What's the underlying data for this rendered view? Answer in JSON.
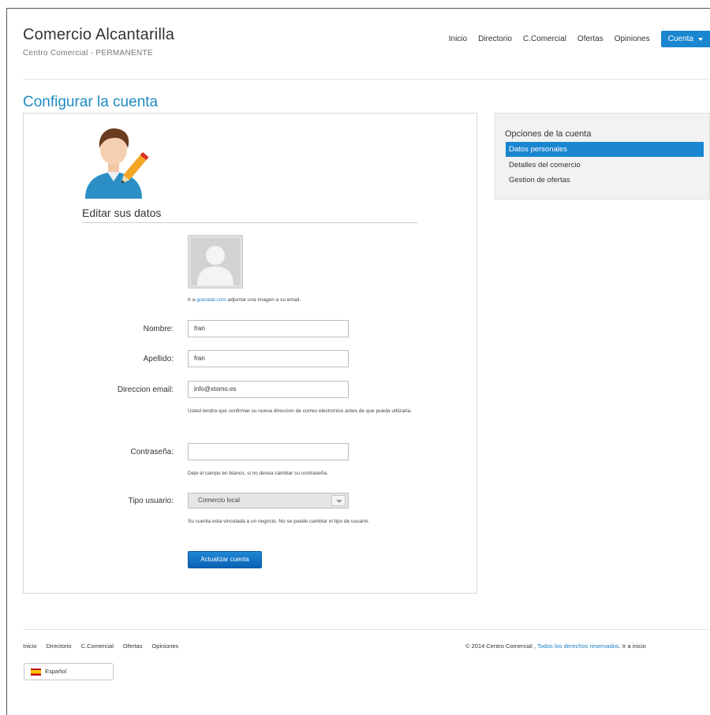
{
  "header": {
    "title": "Comercio Alcantarilla",
    "subtitle": "Centro Comercial - PERMANENTE"
  },
  "nav": {
    "items": [
      "Inicio",
      "Directorio",
      "C.Comercial",
      "Ofertas",
      "Opiniones"
    ],
    "account_label": "Cuenta"
  },
  "page_title": "Configurar la cuenta",
  "profile": {
    "section_title": "Editar sus datos",
    "gravatar_prefix": "Ir a",
    "gravatar_link": "gravatar.com",
    "gravatar_suffix": "adjuntar una imagen a su email."
  },
  "form": {
    "nombre": {
      "label": "Nombre:",
      "value": "fran"
    },
    "apellido": {
      "label": "Apellido:",
      "value": "fran"
    },
    "email": {
      "label": "Direccion email:",
      "value": "info@xtomo.es",
      "help": "Usted tendra que confirmar su nueva direccion de correo electronico antes de que pueda utilizarla."
    },
    "password": {
      "label": "Contraseña:",
      "value": "",
      "help": "Deje el campo en blanco, si no desea cambiar su contraseña."
    },
    "tipo": {
      "label": "Tipo usuario:",
      "value": "Comercio local",
      "help": "Su cuenta esta vinculada a un negocio. No se puede cambiar el tipo de usuario."
    },
    "submit_label": "Actualizar cuenta"
  },
  "sidebar": {
    "title": "Opciones de la cuenta",
    "items": [
      {
        "label": "Datos personales",
        "active": true
      },
      {
        "label": "Detalles del comercio",
        "active": false
      },
      {
        "label": "Gestion de ofertas",
        "active": false
      }
    ]
  },
  "footer": {
    "links": [
      "Inicio",
      "Directorio",
      "C.Comercial",
      "Ofertas",
      "Opiniones"
    ],
    "copyright_prefix": "© 2014 Centro Comercial ,",
    "rights_link": "Todos los derechos reservados.",
    "back_label": "Ir a inicio",
    "language": "Español"
  },
  "colors": {
    "accent": "#1a86d0",
    "title": "#1e8bc3",
    "button": "#0a62b5"
  }
}
